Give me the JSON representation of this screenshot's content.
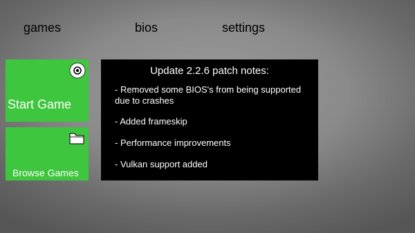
{
  "nav": {
    "games": "games",
    "bios": "bios",
    "settings": "settings"
  },
  "tiles": {
    "start_game": {
      "label": "Start Game",
      "icon": "disc-icon"
    },
    "browse_games": {
      "label": "Browse Games",
      "icon": "folder-icon"
    }
  },
  "patch_notes": {
    "title": "Update 2.2.6 patch notes:",
    "items": [
      "- Removed some BIOS's from being supported due to crashes",
      "- Added frameskip",
      "- Performance improvements",
      "- Vulkan support added"
    ]
  },
  "colors": {
    "tile_green": "#3ec63e",
    "panel_black": "#000000",
    "text_white": "#ffffff"
  }
}
